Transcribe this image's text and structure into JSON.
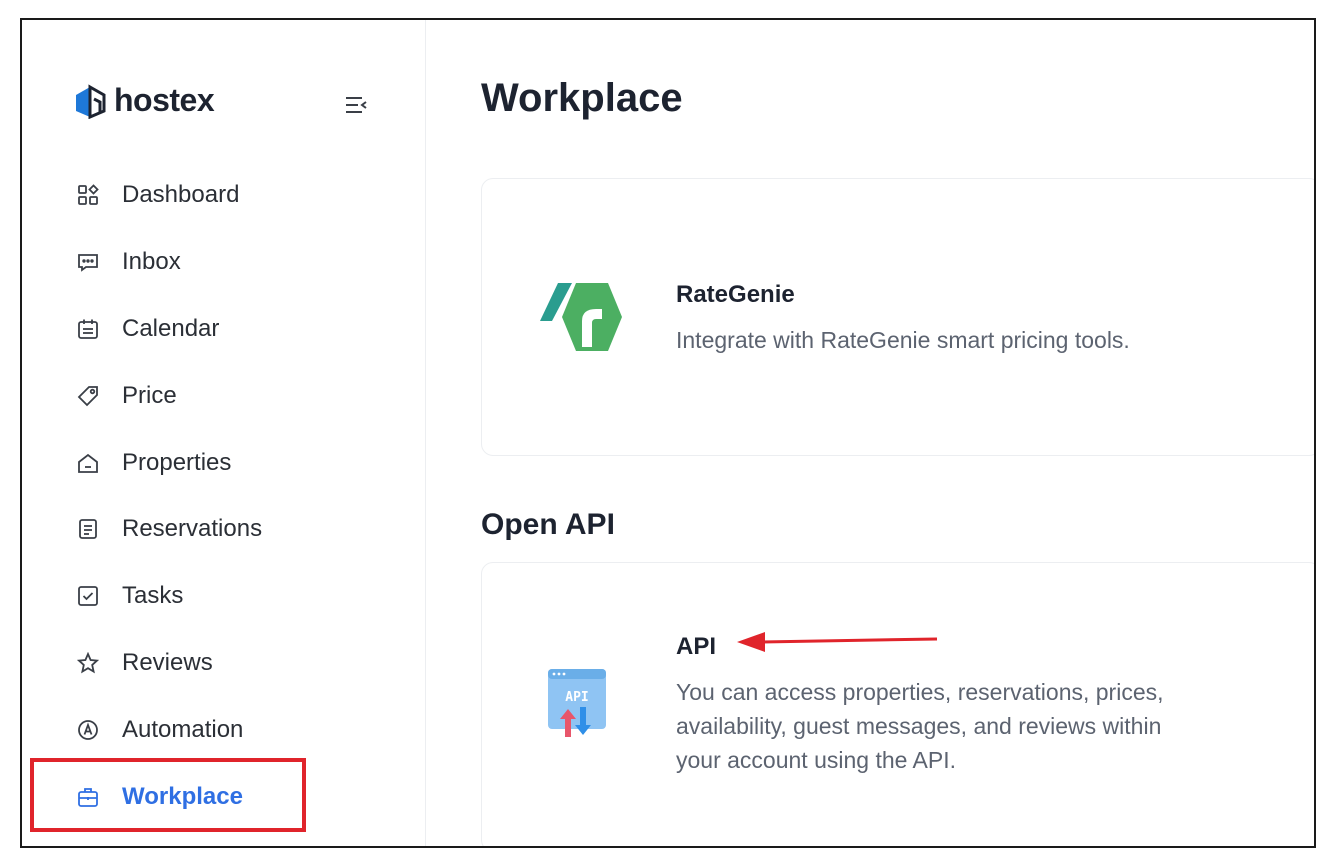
{
  "brand": {
    "name": "hostex"
  },
  "sidebar": {
    "items": [
      {
        "label": "Dashboard",
        "icon": "dashboard-icon"
      },
      {
        "label": "Inbox",
        "icon": "inbox-icon"
      },
      {
        "label": "Calendar",
        "icon": "calendar-icon"
      },
      {
        "label": "Price",
        "icon": "price-tag-icon"
      },
      {
        "label": "Properties",
        "icon": "house-icon"
      },
      {
        "label": "Reservations",
        "icon": "reservations-icon"
      },
      {
        "label": "Tasks",
        "icon": "checkbox-icon"
      },
      {
        "label": "Reviews",
        "icon": "star-icon"
      },
      {
        "label": "Automation",
        "icon": "automation-icon"
      },
      {
        "label": "Workplace",
        "icon": "briefcase-icon",
        "active": true
      }
    ]
  },
  "main": {
    "title": "Workplace",
    "cards": [
      {
        "title": "RateGenie",
        "description": "Integrate with RateGenie smart pricing tools.",
        "icon": "rategenie-logo-icon"
      }
    ],
    "section": {
      "title": "Open API",
      "cards": [
        {
          "title": "API",
          "description_lines": [
            "You can access properties, reservations, prices,",
            "availability, guest messages, and reviews within",
            "your account using the API."
          ],
          "icon": "api-icon",
          "icon_text": "API"
        }
      ]
    }
  },
  "colors": {
    "accent": "#2f6fe3",
    "annotation": "#e0242b",
    "rategenie_green": "#4caf62",
    "rategenie_teal": "#2a9d8f"
  }
}
